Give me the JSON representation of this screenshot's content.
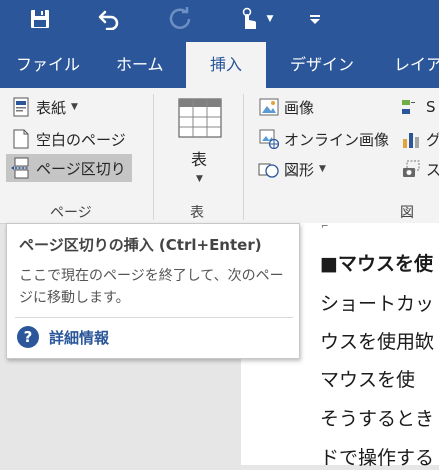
{
  "quick_access": {
    "items": [
      {
        "name": "save",
        "icon": "save-icon"
      },
      {
        "name": "undo",
        "icon": "undo-icon"
      },
      {
        "name": "redo",
        "icon": "redo-icon"
      },
      {
        "name": "touch-mode",
        "icon": "touch-hand-icon"
      },
      {
        "name": "customize",
        "icon": "customize-qat-icon"
      }
    ]
  },
  "tabs": [
    "ファイル",
    "ホーム",
    "挿入",
    "デザイン",
    "レイアウ"
  ],
  "active_tab": "挿入",
  "ribbon": {
    "pages_group": {
      "label": "ページ",
      "cover": "表紙",
      "blank_page": "空白のページ",
      "page_break": "ページ区切り"
    },
    "table_group": {
      "label": "表",
      "table_button": "表"
    },
    "illustrations_group": {
      "label": "図",
      "pictures": "画像",
      "online_pictures": "オンライン画像",
      "shapes": "図形",
      "smartart": "S",
      "chart": "グ",
      "screenshot": "ス"
    }
  },
  "tooltip": {
    "title": "ページ区切りの挿入 (Ctrl+Enter)",
    "description": "ここで現在のページを終了して、次のページに移動します。",
    "link": "詳細情報"
  },
  "document": {
    "lines": [
      "■マウスを使",
      "ショートカッ",
      "ウスを使用缼",
      "マウスを使",
      "そうするとき",
      "ドで操作する"
    ]
  },
  "colors": {
    "brand": "#2b579a",
    "ribbon_bg": "#f3f3f3",
    "selected_button": "#c5c5c5"
  }
}
